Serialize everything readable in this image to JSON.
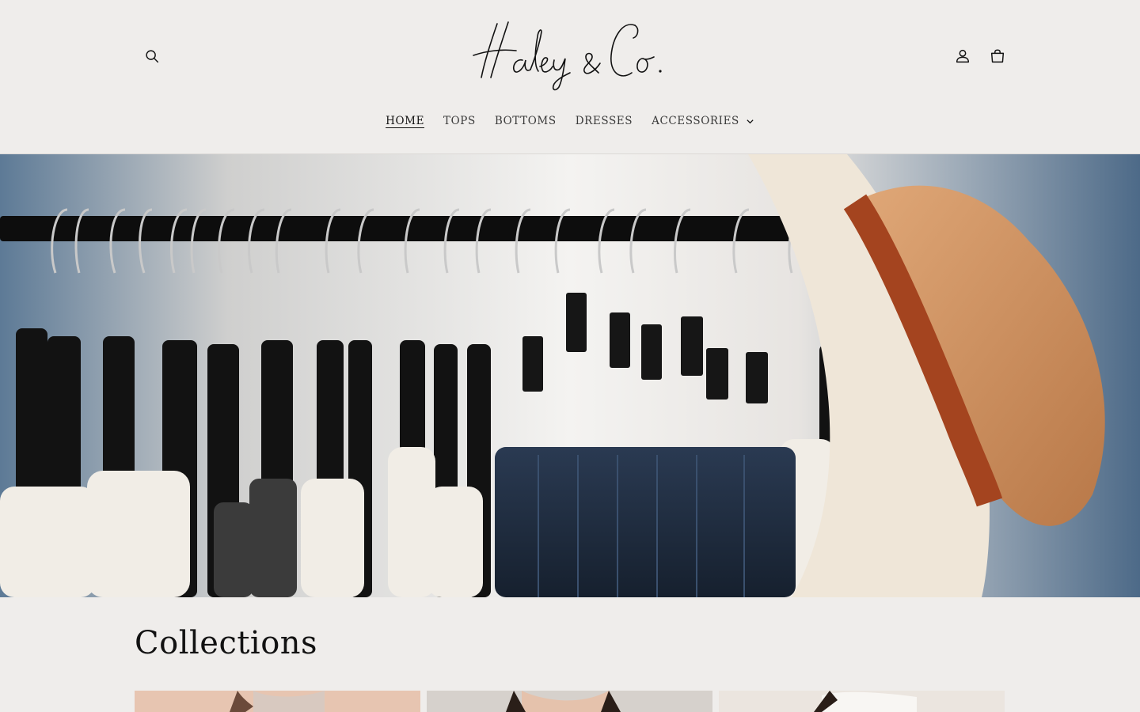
{
  "brand": {
    "logo_text": "Haley & Co."
  },
  "header": {
    "search_icon": "search-icon",
    "account_icon": "account-icon",
    "cart_icon": "cart-icon"
  },
  "nav": {
    "items": [
      {
        "label": "HOME",
        "active": true
      },
      {
        "label": "TOPS",
        "active": false
      },
      {
        "label": "BOTTOMS",
        "active": false
      },
      {
        "label": "DRESSES",
        "active": false
      },
      {
        "label": "ACCESSORIES",
        "active": false,
        "has_dropdown": true
      }
    ]
  },
  "hero": {
    "image": "clothing-rack-with-hangers-denim-and-straw-hat"
  },
  "collections": {
    "title": "Collections",
    "cards": [
      {
        "image": "collection-image-1"
      },
      {
        "image": "collection-image-2"
      },
      {
        "image": "collection-image-3"
      }
    ]
  },
  "colors": {
    "background": "#efedeb",
    "text": "#121212"
  }
}
